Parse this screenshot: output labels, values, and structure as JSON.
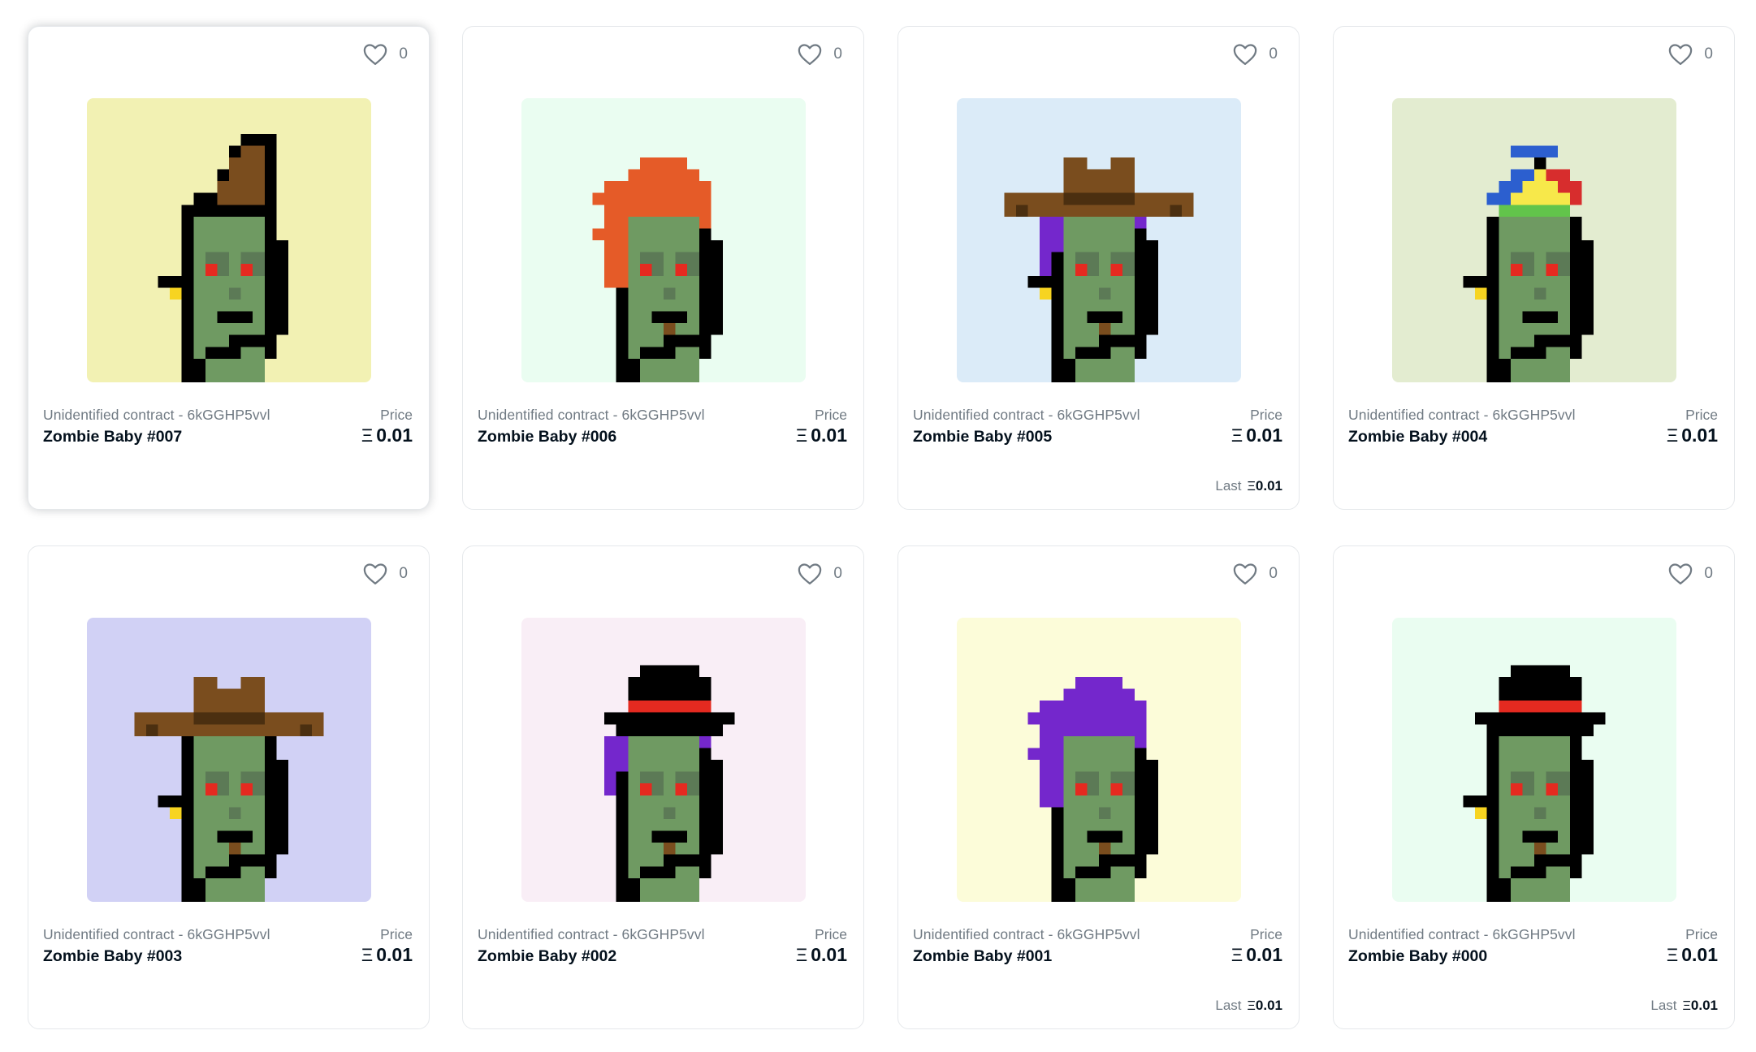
{
  "currency_symbol": "Ξ",
  "cards": [
    {
      "collection": "Unidentified contract - 6kGGHP5vvl",
      "name": "Zombie Baby #007",
      "price_label": "Price",
      "price": "0.01",
      "favorites": "0",
      "last_label": "",
      "last_price": "",
      "bg": "#f2f1b3",
      "hovered": true,
      "head": "mohawk",
      "earring": true
    },
    {
      "collection": "Unidentified contract - 6kGGHP5vvl",
      "name": "Zombie Baby #006",
      "price_label": "Price",
      "price": "0.01",
      "favorites": "0",
      "last_label": "",
      "last_price": "",
      "bg": "#eafdf1",
      "hovered": false,
      "head": "orange-hair",
      "earring": false
    },
    {
      "collection": "Unidentified contract - 6kGGHP5vvl",
      "name": "Zombie Baby #005",
      "price_label": "Price",
      "price": "0.01",
      "favorites": "0",
      "last_label": "Last",
      "last_price": "0.01",
      "bg": "#dbebf8",
      "hovered": false,
      "head": "cowboy-purple",
      "earring": true
    },
    {
      "collection": "Unidentified contract - 6kGGHP5vvl",
      "name": "Zombie Baby #004",
      "price_label": "Price",
      "price": "0.01",
      "favorites": "0",
      "last_label": "",
      "last_price": "",
      "bg": "#e3ecd0",
      "hovered": false,
      "head": "propeller",
      "earring": true
    },
    {
      "collection": "Unidentified contract - 6kGGHP5vvl",
      "name": "Zombie Baby #003",
      "price_label": "Price",
      "price": "0.01",
      "favorites": "0",
      "last_label": "",
      "last_price": "",
      "bg": "#d1d1f5",
      "hovered": false,
      "head": "cowboy",
      "earring": true
    },
    {
      "collection": "Unidentified contract - 6kGGHP5vvl",
      "name": "Zombie Baby #002",
      "price_label": "Price",
      "price": "0.01",
      "favorites": "0",
      "last_label": "",
      "last_price": "",
      "bg": "#f9eef6",
      "hovered": false,
      "head": "tophat-purple",
      "earring": false
    },
    {
      "collection": "Unidentified contract - 6kGGHP5vvl",
      "name": "Zombie Baby #001",
      "price_label": "Price",
      "price": "0.01",
      "favorites": "0",
      "last_label": "Last",
      "last_price": "0.01",
      "bg": "#fcfcd9",
      "hovered": false,
      "head": "purple-hair",
      "earring": false
    },
    {
      "collection": "Unidentified contract - 6kGGHP5vvl",
      "name": "Zombie Baby #000",
      "price_label": "Price",
      "price": "0.01",
      "favorites": "0",
      "last_label": "Last",
      "last_price": "0.01",
      "bg": "#eafdf1",
      "hovered": false,
      "head": "tophat",
      "earring": true
    }
  ],
  "colors": {
    "skin": "#6f9a62",
    "shade": "#5c7a56",
    "outline": "#000000",
    "eye": "#e52a20",
    "mouth_dark": "#000000",
    "mouth_brown": "#7a4d1e",
    "earring": "#f7d421",
    "hat_brown": "#7a4d1e",
    "hat_brown_dark": "#4b2f10",
    "band_red": "#e52a20",
    "orange_hair": "#e55b28",
    "purple": "#7427cc",
    "prop_blue": "#2c5fcf",
    "prop_yellow": "#f7e84a",
    "prop_green": "#62c44b",
    "prop_red": "#d72d2d"
  }
}
